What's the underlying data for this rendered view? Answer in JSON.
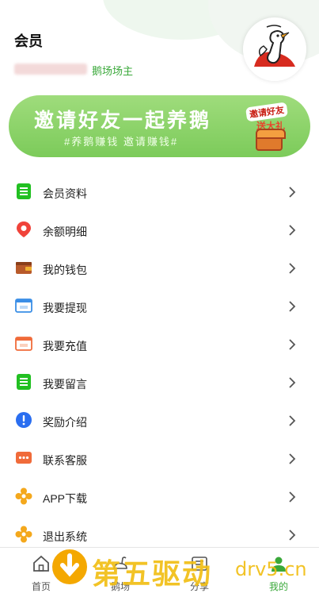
{
  "header": {
    "title": "会员",
    "role": "鹅场场主"
  },
  "banner": {
    "title": "邀请好友一起养鹅",
    "subtitle": "#养鹅赚钱 邀请赚钱#",
    "badge_top": "邀请好友",
    "badge_bottom": "送大礼"
  },
  "menu": {
    "items": [
      {
        "label": "会员资料",
        "icon": "document-list-icon",
        "color": "#22c022"
      },
      {
        "label": "余额明细",
        "icon": "location-pin-icon",
        "color": "#f0433a"
      },
      {
        "label": "我的钱包",
        "icon": "wallet-icon",
        "color": "#b85a2a"
      },
      {
        "label": "我要提现",
        "icon": "withdraw-card-icon",
        "color": "#3a8ee6"
      },
      {
        "label": "我要充值",
        "icon": "recharge-card-icon",
        "color": "#f06b3a"
      },
      {
        "label": "我要留言",
        "icon": "message-list-icon",
        "color": "#22c022"
      },
      {
        "label": "奖励介绍",
        "icon": "info-exclamation-icon",
        "color": "#2a6ef0"
      },
      {
        "label": "联系客服",
        "icon": "chat-bubble-icon",
        "color": "#f06b3a"
      },
      {
        "label": "APP下载",
        "icon": "flower-icon",
        "color": "#f4a81c"
      },
      {
        "label": "退出系统",
        "icon": "flower-icon",
        "color": "#f4a81c"
      }
    ]
  },
  "tabbar": {
    "tabs": [
      {
        "label": "首页",
        "icon": "home-icon",
        "active": false
      },
      {
        "label": "鹅场",
        "icon": "goose-farm-icon",
        "active": false
      },
      {
        "label": "分享",
        "icon": "share-icon",
        "active": false
      },
      {
        "label": "我的",
        "icon": "user-icon",
        "active": true
      }
    ],
    "active_color": "#3aa83a"
  },
  "watermark": {
    "text": "第五驱动",
    "domain": "drv5.cn"
  },
  "colors": {
    "accent": "#3aa83a",
    "banner": "#8ed36c"
  }
}
